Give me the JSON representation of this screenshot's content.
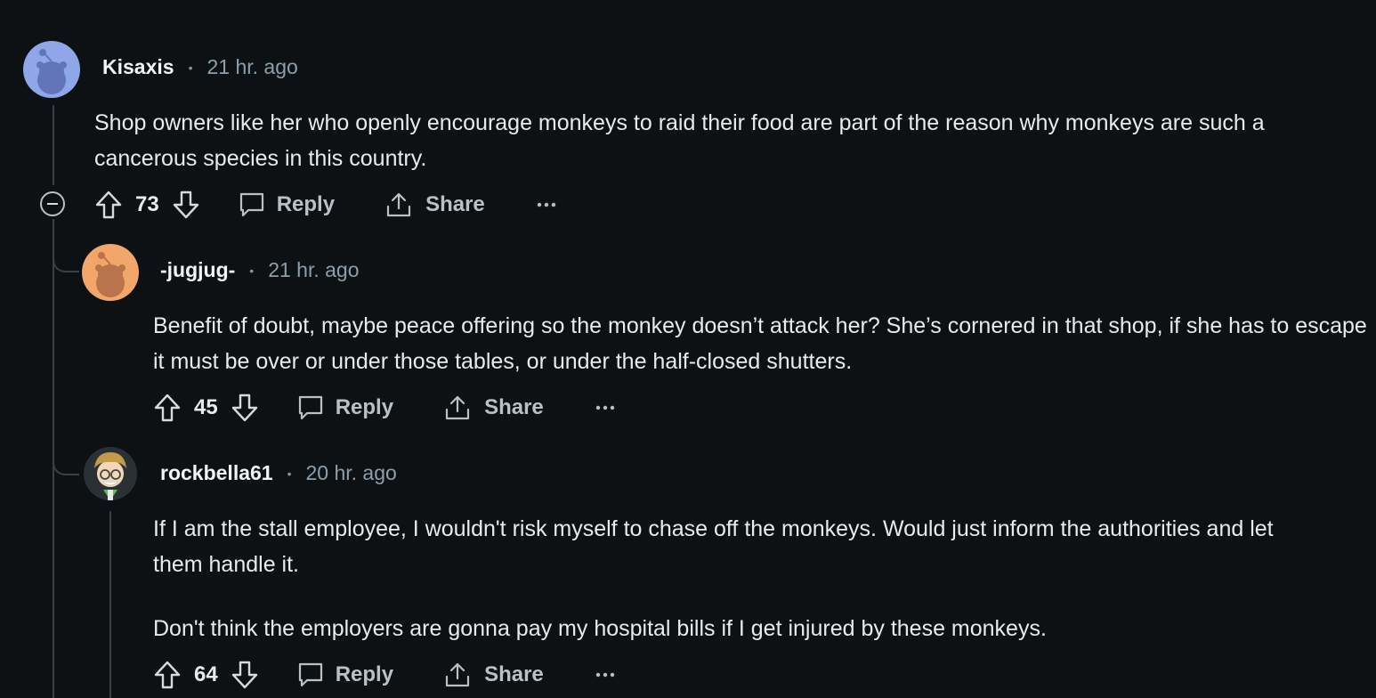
{
  "comments": [
    {
      "author": "Kisaxis",
      "time": "21 hr. ago",
      "body": [
        "Shop owners like her who openly encourage monkeys to raid their food are part of the reason why monkeys are such a cancerous species in this country."
      ],
      "score": "73",
      "reply_label": "Reply",
      "share_label": "Share",
      "avatar_color": "#8fa6e8"
    },
    {
      "author": "-jugjug-",
      "time": "21 hr. ago",
      "body": [
        "Benefit of doubt, maybe peace offering so the monkey doesn’t attack her? She’s cornered in that shop, if she has to escape it must be over or under those tables, or under the half-closed shutters."
      ],
      "score": "45",
      "reply_label": "Reply",
      "share_label": "Share",
      "avatar_color": "#f2a66a"
    },
    {
      "author": "rockbella61",
      "time": "20 hr. ago",
      "body": [
        "If I am the stall employee, I wouldn't risk myself to chase off the monkeys. Would just inform the authorities and let them handle it.",
        "Don't think the employers are gonna pay my hospital bills if I get injured by these monkeys."
      ],
      "score": "64",
      "reply_label": "Reply",
      "share_label": "Share",
      "avatar_color": "#2a3034"
    }
  ],
  "colors": {
    "background": "#0e1113",
    "thread_line": "#3b4044",
    "muted": "#8ba0ad"
  },
  "icons": [
    "upvote-icon",
    "downvote-icon",
    "comment-icon",
    "share-icon",
    "more-icon",
    "collapse-icon"
  ]
}
